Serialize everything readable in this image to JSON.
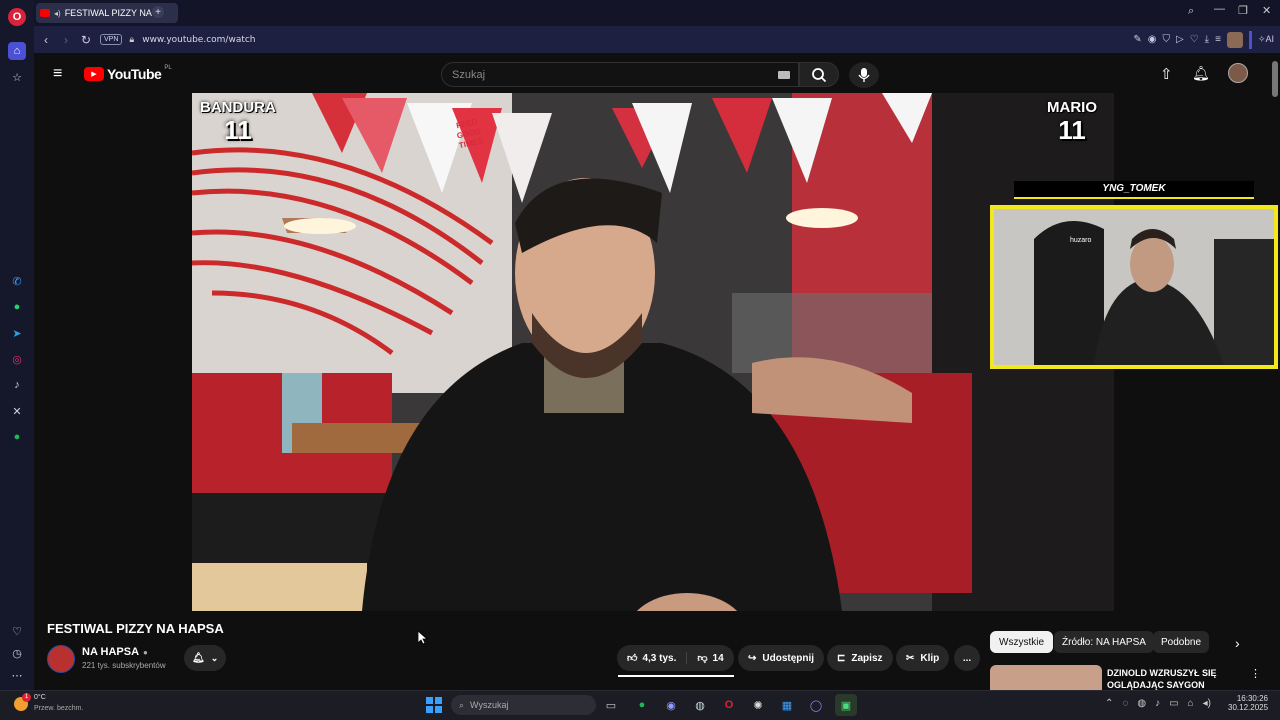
{
  "browser": {
    "tab_title": "FESTIWAL PIZZY NA H",
    "url": "www.youtube.com/watch",
    "vpn_label": "VPN",
    "ai_label": "AI"
  },
  "youtube": {
    "logo_text": "YouTube",
    "region": "PL",
    "search_placeholder": "Szukaj"
  },
  "video": {
    "left_overlay": {
      "name": "BANDURA",
      "number": "11"
    },
    "right_overlay": {
      "name": "MARIO",
      "number": "11"
    },
    "streamer_name": "YNG_TOMEK",
    "banner_text": "FEED GOOD TIMES",
    "chair_brand": "huzaro"
  },
  "details": {
    "title": "FESTIWAL PIZZY NA HAPSA",
    "channel_name": "NA HAPSA",
    "subscribers": "221 tys. subskrybentów",
    "likes": "4,3 tys.",
    "dislikes": "14",
    "share_label": "Udostępnij",
    "save_label": "Zapisz",
    "clip_label": "Klip",
    "more_label": "..."
  },
  "chips": [
    "Wszystkie",
    "Źródło: NA HAPSA",
    "Podobne"
  ],
  "recommendation": {
    "title_line1": "DZINOLD WZRUSZYŁ SIĘ",
    "title_line2": "OGLĄDAJĄC SAYGON"
  },
  "taskbar": {
    "weather_temp": "0°C",
    "weather_desc": "Przew. bezchm.",
    "search_placeholder": "Wyszukaj",
    "time": "16:30:26",
    "date": "30.12.2025",
    "notif_count": "1"
  },
  "colors": {
    "yt_red": "#ff0000",
    "overlay_yellow": "#f2e81a",
    "opera_red": "#e0203a",
    "sidebar_accent": "#4b50d4"
  }
}
